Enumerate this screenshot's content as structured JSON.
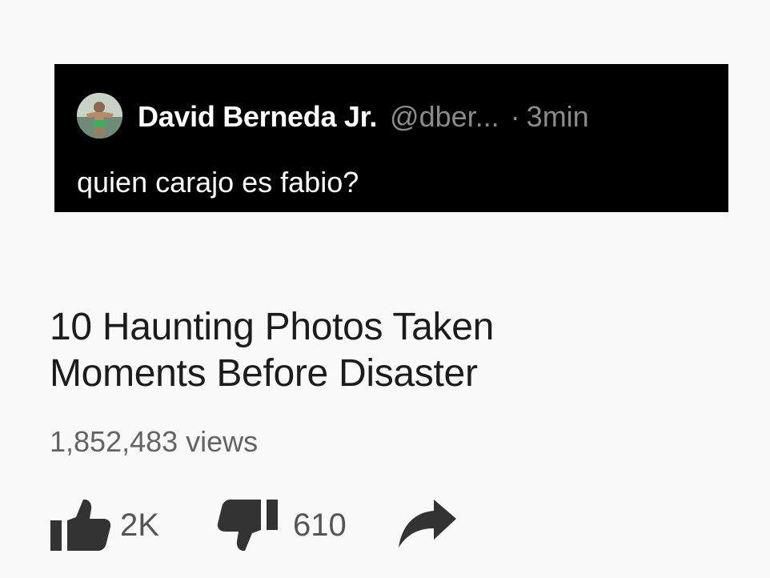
{
  "tweet": {
    "author_name": "David Berneda Jr.",
    "handle": "@dber...",
    "separator": "·",
    "time": "3min",
    "text": "quien carajo es fabio?",
    "avatar_icon": "profile-photo"
  },
  "video": {
    "title_lines": [
      "10 Haunting Photos Taken",
      "Moments Before Disaster"
    ],
    "views": "1,852,483 views",
    "likes": "2K",
    "dislikes": "610",
    "like_icon": "thumbs-up-icon",
    "dislike_icon": "thumbs-down-icon",
    "share_icon": "share-arrow-icon"
  },
  "colors": {
    "tweet_background": "#000000",
    "page_background": "#f9f9f9",
    "muted_text": "#8b8b8b",
    "title_text": "#1c1c1c"
  }
}
